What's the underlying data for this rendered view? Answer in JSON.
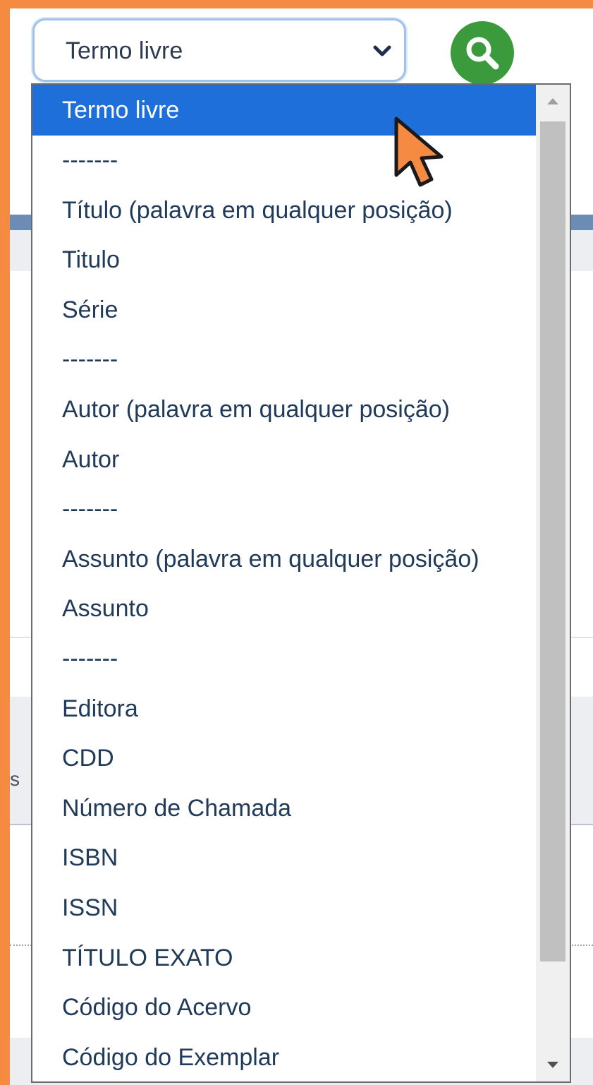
{
  "select": {
    "value": "Termo livre"
  },
  "background": {
    "stray_letter": "s"
  },
  "dropdown": {
    "options": [
      "Termo livre",
      "-------",
      "Título (palavra em qualquer posição)",
      "Titulo",
      "Série",
      "-------",
      "Autor (palavra em qualquer posição)",
      "Autor",
      "-------",
      "Assunto (palavra em qualquer posição)",
      "Assunto",
      "-------",
      "Editora",
      "CDD",
      "Número de Chamada",
      "ISBN",
      "ISSN",
      "TÍTULO EXATO",
      "Código do Acervo",
      "Código do Exemplar"
    ],
    "selected_index": 0
  },
  "icons": {
    "select_chevron": "chevron-down-icon",
    "search": "search-icon",
    "cursor": "mouse-pointer-icon",
    "scroll_up": "arrow-up-icon",
    "scroll_down": "arrow-down-icon"
  },
  "colors": {
    "frame": "#f58a43",
    "selected_option": "#1e6fd9",
    "search_button": "#3a9a3c",
    "option_text": "#203a5a"
  }
}
